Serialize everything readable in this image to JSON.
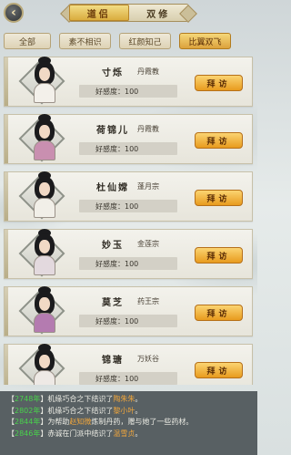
{
  "header": {
    "tabs": [
      {
        "label": "道侣",
        "active": true
      },
      {
        "label": "双修",
        "active": false
      }
    ]
  },
  "filters": [
    {
      "label": "全部",
      "active": false
    },
    {
      "label": "素不相识",
      "active": false
    },
    {
      "label": "红颜知己",
      "active": false
    },
    {
      "label": "比翼双飞",
      "active": true
    }
  ],
  "favor_label": "好感度：",
  "visit_label": "拜访",
  "characters": [
    {
      "name": "寸烁",
      "sect": "丹霞教",
      "favor": "100",
      "robe": "#f3f0ea"
    },
    {
      "name": "荷锦儿",
      "sect": "丹霞教",
      "favor": "100",
      "robe": "#c98fb0"
    },
    {
      "name": "杜仙嫦",
      "sect": "蓬月宗",
      "favor": "100",
      "robe": "#f1efe8"
    },
    {
      "name": "妙玉",
      "sect": "金莲宗",
      "favor": "100",
      "robe": "#e3d9de"
    },
    {
      "name": "莫芝",
      "sect": "药王宗",
      "favor": "100",
      "robe": "#b47bb0"
    },
    {
      "name": "锦瑭",
      "sect": "万妖谷",
      "favor": "100",
      "robe": "#eee9e5"
    }
  ],
  "log": [
    {
      "year": "2748年",
      "text": "机缘巧合之下结识了",
      "name": "陶朱朱",
      "suffix": "。"
    },
    {
      "year": "2802年",
      "text": "机缘巧合之下结识了",
      "name": "黎小叶",
      "suffix": "。"
    },
    {
      "year": "2844年",
      "text": "为帮助",
      "name": "赵知微",
      "suffix": "炼制丹药，赠与她了一些药材。"
    },
    {
      "year": "2846年",
      "text": "赤诚在门派中结识了",
      "name": "温雪贞",
      "suffix": "。"
    }
  ],
  "colors": {
    "accent_gold": "#e89b1e",
    "log_year": "#49d24c",
    "log_name": "#f0a63c"
  }
}
